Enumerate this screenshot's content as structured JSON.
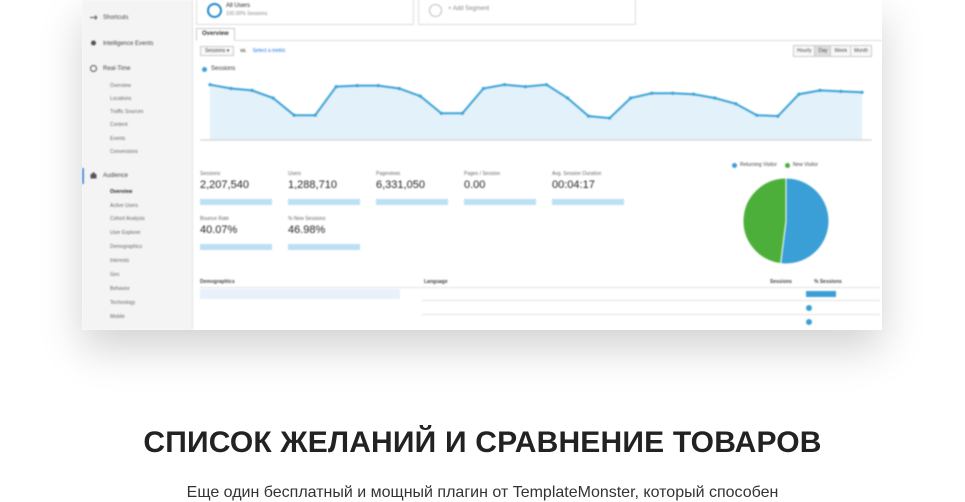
{
  "screenshot": {
    "sidebar": {
      "items": [
        {
          "label": "Shortcuts",
          "icon": "shortcuts-icon"
        },
        {
          "label": "Intelligence Events",
          "icon": "lightbulb-icon"
        },
        {
          "label": "Real-Time",
          "icon": "clock-icon"
        },
        {
          "label": "Audience",
          "icon": "people-icon"
        }
      ],
      "realtime_sub": [
        "Overview",
        "Locations",
        "Traffic Sources",
        "Content",
        "Events",
        "Conversions"
      ],
      "audience_sub": [
        "Overview",
        "Active Users",
        "Cohort Analysis",
        "User Explorer",
        "Demographics",
        "Interests",
        "Geo",
        "Behavior",
        "Technology",
        "Mobile"
      ]
    },
    "segment": {
      "title": "All Users",
      "subtitle": "100.00% Sessions",
      "add_label": "+ Add Segment"
    },
    "tab": "Overview",
    "controls": {
      "metric": "Sessions",
      "vs": "vs.",
      "select": "Select a metric"
    },
    "granularity": [
      "Hourly",
      "Day",
      "Week",
      "Month"
    ],
    "granularity_selected": "Day",
    "chart_legend": "Sessions",
    "chart_data": {
      "type": "area",
      "series": [
        {
          "name": "Sessions",
          "values": [
            118,
            114,
            112,
            104,
            86,
            86,
            116,
            117,
            117,
            114,
            106,
            88,
            88,
            114,
            118,
            116,
            118,
            104,
            85,
            83,
            104,
            109,
            109,
            108,
            104,
            98,
            86,
            85,
            108,
            112,
            111,
            110
          ]
        }
      ],
      "color": "#3aa1d6"
    },
    "metrics": [
      {
        "label": "Sessions",
        "value": "2,207,540"
      },
      {
        "label": "Users",
        "value": "1,288,710"
      },
      {
        "label": "Pageviews",
        "value": "6,331,050"
      },
      {
        "label": "Pages / Session",
        "value": "0.00"
      },
      {
        "label": "Avg. Session Duration",
        "value": "00:04:17"
      },
      {
        "label": "Bounce Rate",
        "value": "40.07%"
      },
      {
        "label": "% New Sessions",
        "value": "46.98%"
      }
    ],
    "pie": {
      "legend": [
        "Returning Visitor",
        "New Visitor"
      ],
      "values": [
        52,
        48
      ],
      "colors": [
        "#3a9fd6",
        "#4caf3a"
      ]
    },
    "table": {
      "headers": [
        "Demographics",
        "Language",
        "Sessions",
        "% Sessions"
      ]
    }
  },
  "heading": "СПИСОК ЖЕЛАНИЙ И СРАВНЕНИЕ ТОВАРОВ",
  "description": "Еще один бесплатный и мощный плагин от TemplateMonster, который способен"
}
